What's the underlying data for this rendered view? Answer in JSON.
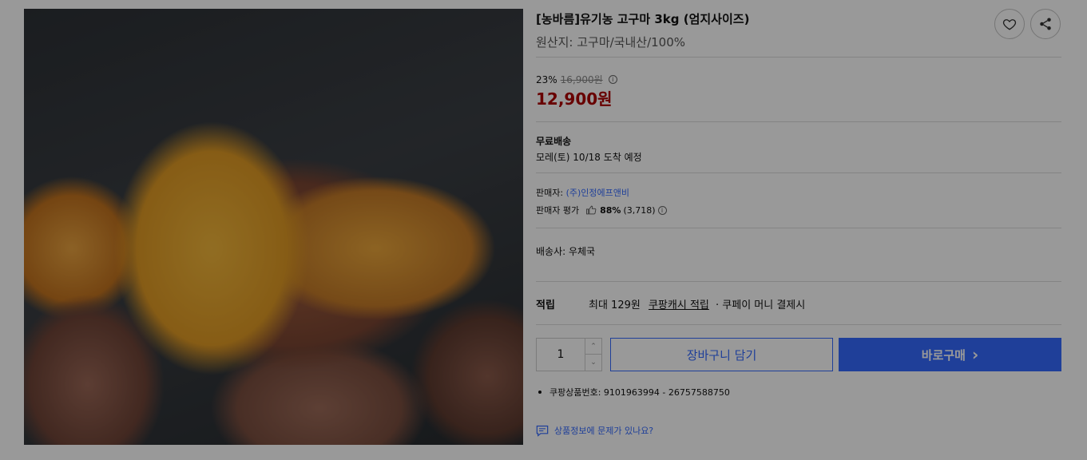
{
  "product": {
    "title": "[농바름]유기농 고구마 3kg (엄지사이즈)",
    "origin": "원산지: 고구마/국내산/100%"
  },
  "header_actions": {
    "wishlist_icon": "heart-icon",
    "share_icon": "share-icon"
  },
  "price": {
    "discount_rate": "23%",
    "original_price": "16,900원",
    "sale_price": "12,900원",
    "info_icon": "i"
  },
  "shipping": {
    "label": "무료배송",
    "arrival": "모레(토) 10/18 도착 예정"
  },
  "seller": {
    "prefix": "판매자: ",
    "name": "(주)인정에프앤비",
    "rating_label": "판매자 평가",
    "rating_percent": "88%",
    "rating_count": "(3,718)"
  },
  "courier": {
    "text": "배송사: 우체국"
  },
  "reward": {
    "label": "적립",
    "amount_text": "최대 129원",
    "cash_link": "쿠팡캐시 적립",
    "suffix": "· 쿠페이 머니 결제시"
  },
  "purchase": {
    "quantity": "1",
    "up_glyph": "⌃",
    "down_glyph": "⌄",
    "cart_label": "장바구니 담기",
    "buy_label": "바로구매",
    "buy_arrow": "›"
  },
  "product_number": {
    "text": "쿠팡상품번호: 9101963994 - 26757588750"
  },
  "report": {
    "text": "상품정보에 문제가 있나요?"
  },
  "colors": {
    "accent_blue": "#346aff",
    "price_red": "#ae0000",
    "overlay": "rgba(0,0,0,0.40)"
  }
}
